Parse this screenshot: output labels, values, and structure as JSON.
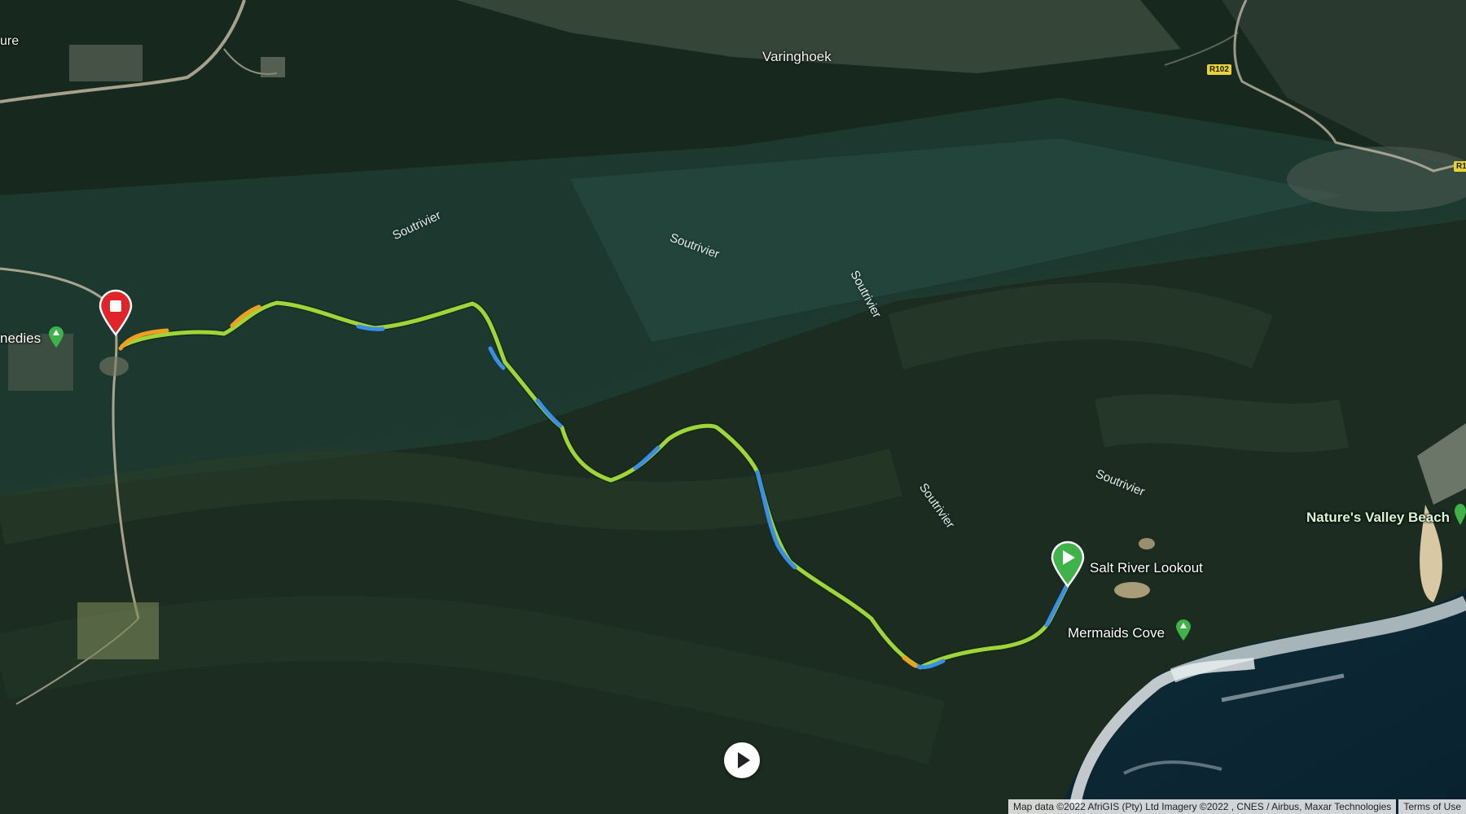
{
  "map": {
    "place_labels": {
      "top_left": "ure",
      "varinghoek": "Varinghoek",
      "left_poi": "nedies",
      "natures_valley": "Nature's Valley Beach",
      "salt_river_lookout": "Salt River Lookout",
      "mermaids_cove": "Mermaids Cove"
    },
    "river_labels": [
      "Soutrivier",
      "Soutrivier",
      "Soutrivier",
      "Soutrivier",
      "Soutrivier"
    ],
    "road_shields": [
      "R102",
      "R1"
    ],
    "attribution": "Map data ©2022 AfriGIS (Pty) Ltd Imagery ©2022 , CNES / Airbus, Maxar Technologies",
    "terms": "Terms of Use",
    "colors": {
      "route_green": "#9fd43a",
      "route_blue": "#3a8ee6",
      "route_orange": "#f0a020",
      "start_pin": "#3fb24a",
      "end_pin": "#e0252a",
      "poi_pin": "#3fb24a"
    },
    "icons": {
      "start": "play-pin-icon",
      "end": "stop-pin-icon",
      "poi": "park-pin-icon",
      "player": "play-button-icon"
    }
  }
}
